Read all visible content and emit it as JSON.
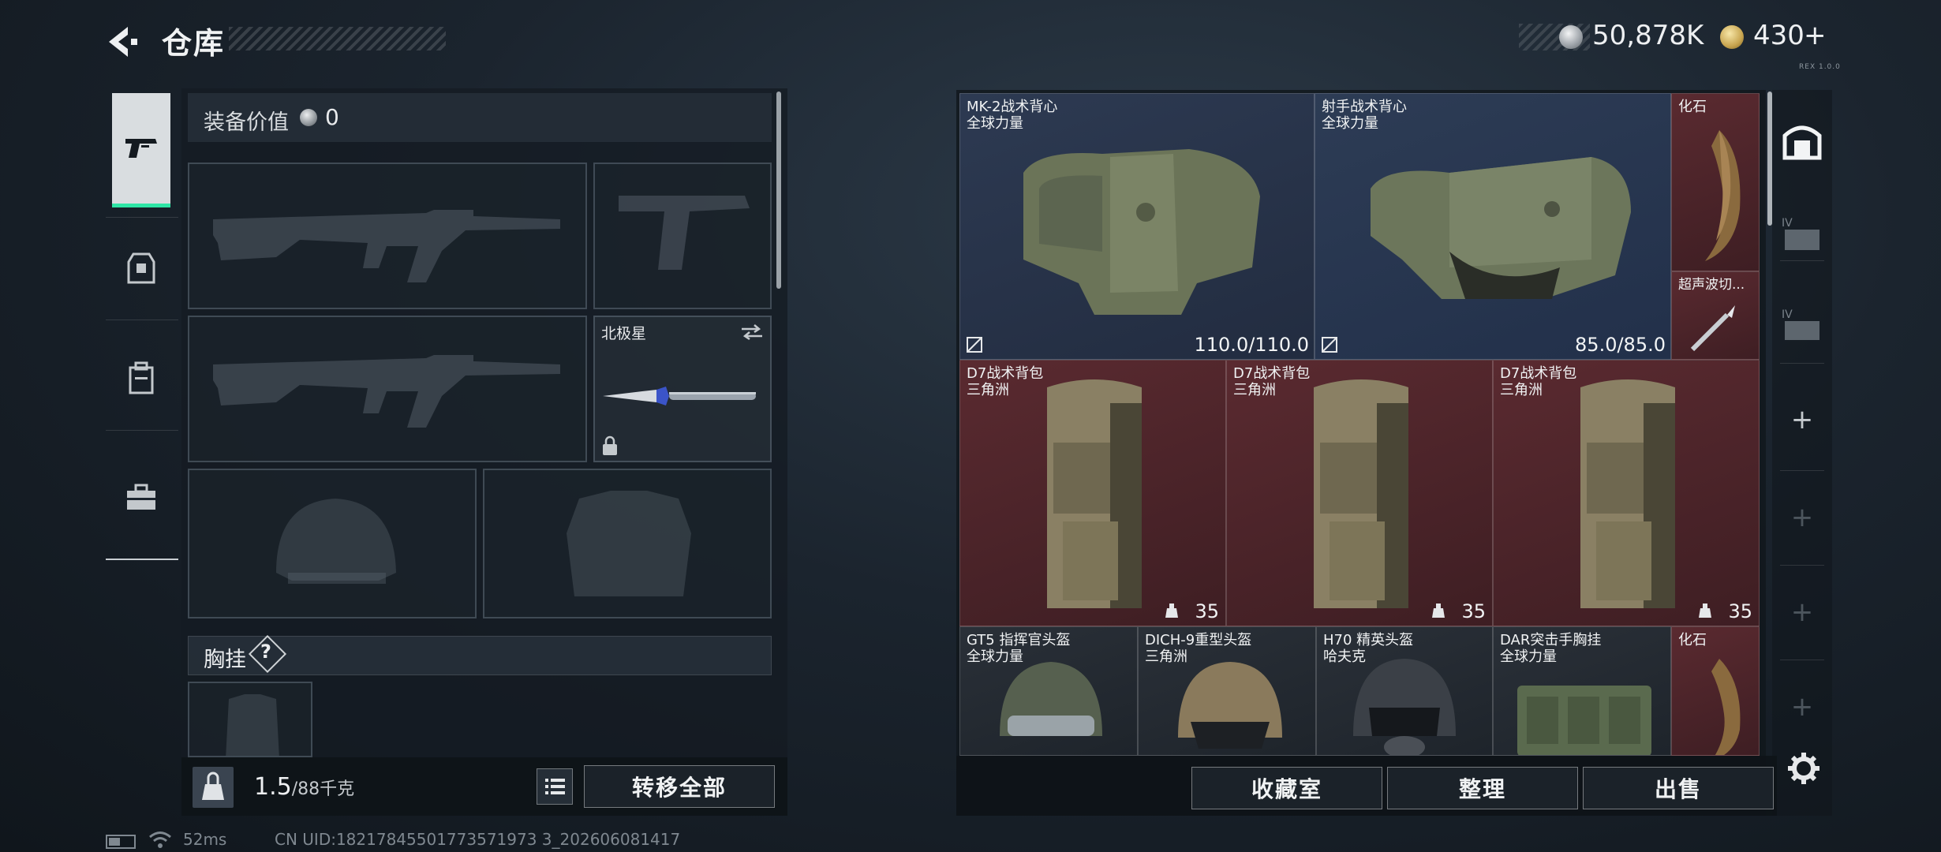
{
  "header": {
    "title": "仓库",
    "currency_silver": "50,878K",
    "currency_gold": "430",
    "gold_plus": "+",
    "version": "REX 1.0.0"
  },
  "equipment": {
    "value_label": "装备价值",
    "value": "0",
    "melee_name": "北极星",
    "chest_rig_label": "胸挂",
    "chest_rig_help": "?",
    "weight_value": "1.5",
    "weight_max": "/88千克",
    "transfer_all": "转移全部"
  },
  "storage": {
    "items": [
      {
        "name": "MK-2战术背心",
        "origin": "全球力量",
        "durability": "110.0/110.0",
        "bg": "#2d3a52"
      },
      {
        "name": "射手战术背心",
        "origin": "全球力量",
        "durability": "85.0/85.0",
        "bg": "#2d3c55"
      },
      {
        "name": "化石",
        "origin": "",
        "bg": "#5a2a30"
      },
      {
        "name": "超声波切...",
        "origin": "",
        "bg": "#5a2a30"
      },
      {
        "name": "D7战术背包",
        "origin": "三角洲",
        "capacity": "35",
        "bg": "#5a2a30"
      },
      {
        "name": "D7战术背包",
        "origin": "三角洲",
        "capacity": "35",
        "bg": "#5a2a30"
      },
      {
        "name": "D7战术背包",
        "origin": "三角洲",
        "capacity": "35",
        "bg": "#5a2a30"
      },
      {
        "name": "GT5 指挥官头盔",
        "origin": "全球力量",
        "bg": "#2a3038"
      },
      {
        "name": "DICH-9重型头盔",
        "origin": "三角洲",
        "bg": "#2a3038"
      },
      {
        "name": "H70 精英头盔",
        "origin": "哈夫克",
        "bg": "#2a3038"
      },
      {
        "name": "DAR突击手胸挂",
        "origin": "全球力量",
        "bg": "#2a3038"
      },
      {
        "name": "化石",
        "origin": "",
        "bg": "#5a2a30"
      }
    ],
    "buttons": {
      "collection": "收藏室",
      "organize": "整理",
      "sell": "出售"
    }
  },
  "status": {
    "ping": "52ms",
    "uid": "CN UID:18217845501773571973 3_202606081417"
  }
}
